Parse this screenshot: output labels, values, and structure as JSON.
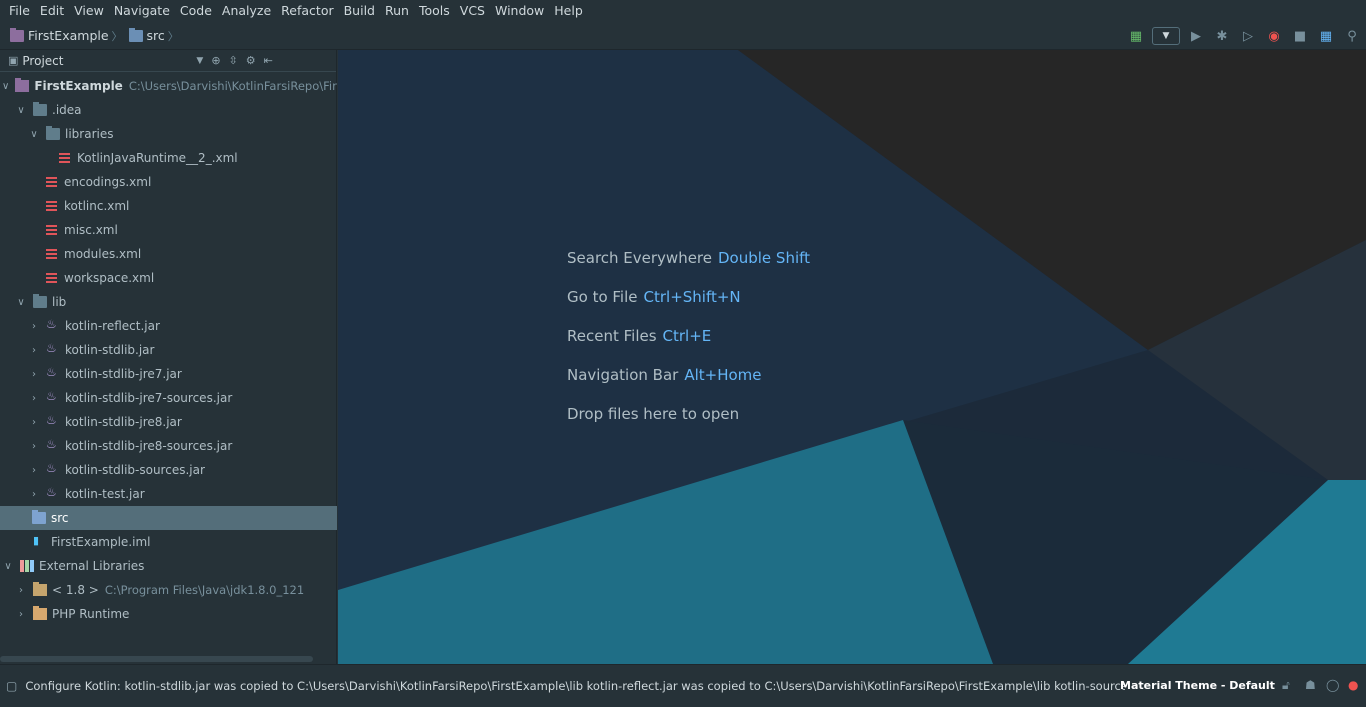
{
  "menu": [
    "File",
    "Edit",
    "View",
    "Navigate",
    "Code",
    "Analyze",
    "Refactor",
    "Build",
    "Run",
    "Tools",
    "VCS",
    "Window",
    "Help"
  ],
  "breadcrumb": {
    "project": "FirstExample",
    "folder": "src"
  },
  "panel": {
    "title": "Project"
  },
  "tree": [
    {
      "label": "FirstExample",
      "path": "C:\\Users\\Darvishi\\KotlinFarsiRepo\\FirstExample"
    },
    {
      "label": ".idea"
    },
    {
      "label": "libraries"
    },
    {
      "label": "KotlinJavaRuntime__2_.xml"
    },
    {
      "label": "encodings.xml"
    },
    {
      "label": "kotlinc.xml"
    },
    {
      "label": "misc.xml"
    },
    {
      "label": "modules.xml"
    },
    {
      "label": "workspace.xml"
    },
    {
      "label": "lib"
    },
    {
      "label": "kotlin-reflect.jar"
    },
    {
      "label": "kotlin-stdlib.jar"
    },
    {
      "label": "kotlin-stdlib-jre7.jar"
    },
    {
      "label": "kotlin-stdlib-jre7-sources.jar"
    },
    {
      "label": "kotlin-stdlib-jre8.jar"
    },
    {
      "label": "kotlin-stdlib-jre8-sources.jar"
    },
    {
      "label": "kotlin-stdlib-sources.jar"
    },
    {
      "label": "kotlin-test.jar"
    },
    {
      "label": "src"
    },
    {
      "label": "FirstExample.iml"
    },
    {
      "label": "External Libraries"
    },
    {
      "label": "< 1.8 >",
      "path": "C:\\Program Files\\Java\\jdk1.8.0_121"
    },
    {
      "label": "PHP Runtime"
    }
  ],
  "hints": [
    {
      "label": "Search Everywhere",
      "key": "Double Shift"
    },
    {
      "label": "Go to File",
      "key": "Ctrl+Shift+N"
    },
    {
      "label": "Recent Files",
      "key": "Ctrl+E"
    },
    {
      "label": "Navigation Bar",
      "key": "Alt+Home"
    },
    {
      "label": "Drop files here to open",
      "key": ""
    }
  ],
  "status": {
    "message": "Configure Kotlin: kotlin-stdlib.jar was copied to C:\\Users\\Darvishi\\KotlinFarsiRepo\\FirstExample\\lib kotlin-reflect.jar was copied to C:\\Users\\Darvishi\\KotlinFarsiRepo\\FirstExample\\lib kotlin-sources.jar was copied to...",
    "theme": "Material Theme - Default"
  },
  "colors": {
    "accent": "#64b5f6",
    "background": "#263238",
    "selection": "#546e7a"
  }
}
